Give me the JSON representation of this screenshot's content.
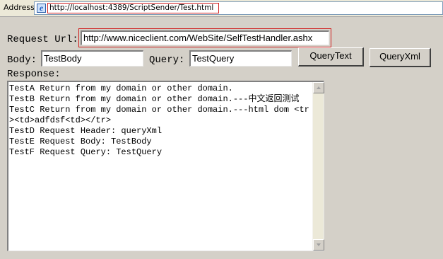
{
  "address_bar": {
    "label": "Address",
    "url": "http://localhost:4389/ScriptSender/Test.html"
  },
  "form": {
    "request_url_label": "Request Url:",
    "request_url_value": "http://www.niceclient.com/WebSite/SelfTestHandler.ashx",
    "body_label": "Body:",
    "body_value": "TestBody",
    "query_label": "Query:",
    "query_value": "TestQuery",
    "query_text_button": "QueryText",
    "query_xml_button": "QueryXml",
    "response_label": "Response:",
    "response_text": "TestA Return from my domain or other domain.\nTestB Return from my domain or other domain.---中文返回测试\nTestC Return from my domain or other domain.---html dom <tr><td>adfdsf<td></tr>\nTestD Request Header: queryXml\nTestE Request Body: TestBody\nTestF Request Query: TestQuery"
  },
  "icons": {
    "page_icon": "ie-page-icon",
    "scroll_up": "scroll-up-arrow-icon",
    "scroll_down": "scroll-down-arrow-icon"
  },
  "colors": {
    "highlight_outline": "#d02020",
    "window_background": "#d4d0c8"
  }
}
